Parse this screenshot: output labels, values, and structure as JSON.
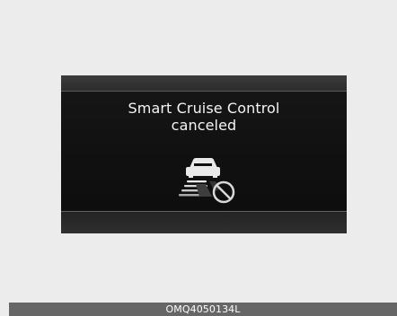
{
  "display": {
    "message_line_1": "Smart Cruise Control",
    "message_line_2": "canceled",
    "icon": "smart-cruise-canceled-icon"
  },
  "footer": {
    "code": "OMQ4050134L"
  },
  "colors": {
    "background": "#ececec",
    "panel_dark": "#101010",
    "panel_band": "#2f2f2f",
    "text": "#f4f4f4",
    "footer_bar": "#666666"
  }
}
